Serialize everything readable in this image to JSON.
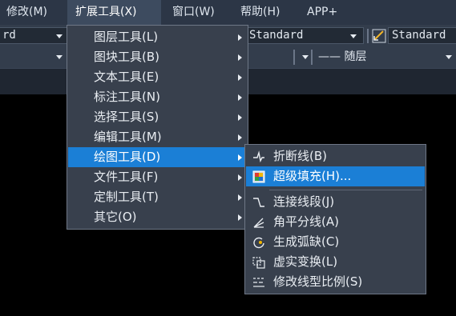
{
  "menubar": {
    "items": [
      {
        "label": "修改(M)"
      },
      {
        "label": "扩展工具(X)"
      },
      {
        "label": "窗口(W)"
      },
      {
        "label": "帮助(H)"
      },
      {
        "label": "APP+"
      }
    ]
  },
  "toolbar": {
    "left_combo": "rd",
    "style_combo": "Standard",
    "dim_style_combo": "Standard",
    "linetype_combo": "—— 随层"
  },
  "ext_menu": {
    "items": [
      {
        "label": "图层工具(L)"
      },
      {
        "label": "图块工具(B)"
      },
      {
        "label": "文本工具(E)"
      },
      {
        "label": "标注工具(N)"
      },
      {
        "label": "选择工具(S)"
      },
      {
        "label": "编辑工具(M)"
      },
      {
        "label": "绘图工具(D)"
      },
      {
        "label": "文件工具(F)"
      },
      {
        "label": "定制工具(T)"
      },
      {
        "label": "其它(O)"
      }
    ]
  },
  "draw_submenu": {
    "items": [
      {
        "label": "折断线(B)",
        "icon": "break-line-icon"
      },
      {
        "label": "超级填充(H)...",
        "icon": "super-hatch-icon"
      },
      {
        "label": "连接线段(J)",
        "icon": "join-lines-icon"
      },
      {
        "label": "角平分线(A)",
        "icon": "angle-bisector-icon"
      },
      {
        "label": "生成弧缺(C)",
        "icon": "arc-gap-icon"
      },
      {
        "label": "虚实变换(L)",
        "icon": "dash-solid-toggle-icon"
      },
      {
        "label": "修改线型比例(S)",
        "icon": "linetype-scale-icon"
      }
    ]
  },
  "colors": {
    "menubar": "#2c3646",
    "menu_bg": "#38404d",
    "highlight": "#1b7fd6",
    "canvas": "#000000"
  }
}
